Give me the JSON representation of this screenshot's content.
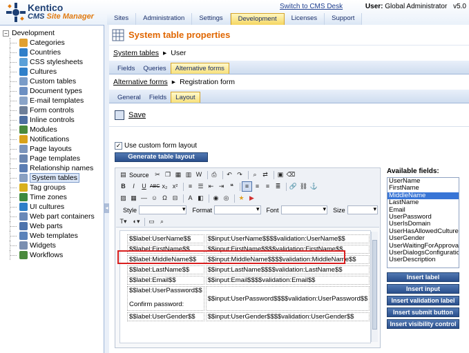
{
  "app": {
    "brand": "Kentico",
    "product_prefix": "CMS ",
    "product_suffix": "Site Manager",
    "version": "v5.0"
  },
  "header": {
    "switch_link": "Switch to CMS Desk",
    "user_label": "User:",
    "user_name": "Global Administrator",
    "main_tabs": [
      "Sites",
      "Administration",
      "Settings",
      "Development",
      "Licenses",
      "Support"
    ],
    "active_tab": "Development"
  },
  "tree": {
    "root": "Development",
    "items": [
      {
        "label": "Categories",
        "icon": "categories-icon",
        "color": "#e0a030"
      },
      {
        "label": "Countries",
        "icon": "globe-icon",
        "color": "#2f7fc9"
      },
      {
        "label": "CSS stylesheets",
        "icon": "css-icon",
        "color": "#5aa0d8"
      },
      {
        "label": "Cultures",
        "icon": "globe-icon",
        "color": "#2f7fc9"
      },
      {
        "label": "Custom tables",
        "icon": "table-icon",
        "color": "#7a9cc8"
      },
      {
        "label": "Document types",
        "icon": "document-icon",
        "color": "#6c8fc2"
      },
      {
        "label": "E-mail templates",
        "icon": "email-icon",
        "color": "#8aa4c8"
      },
      {
        "label": "Form controls",
        "icon": "form-control-icon",
        "color": "#6e7f99"
      },
      {
        "label": "Inline controls",
        "icon": "inline-control-icon",
        "color": "#4e6fa1"
      },
      {
        "label": "Modules",
        "icon": "modules-icon",
        "color": "#4a8a3c"
      },
      {
        "label": "Notifications",
        "icon": "notification-icon",
        "color": "#d9a21b"
      },
      {
        "label": "Page layouts",
        "icon": "layout-icon",
        "color": "#7c95bb"
      },
      {
        "label": "Page templates",
        "icon": "template-icon",
        "color": "#6b86b0"
      },
      {
        "label": "Relationship names",
        "icon": "relationship-icon",
        "color": "#5b7db3"
      },
      {
        "label": "System tables",
        "icon": "system-table-icon",
        "color": "#8aa0c0"
      },
      {
        "label": "Tag groups",
        "icon": "tag-icon",
        "color": "#d9b01b"
      },
      {
        "label": "Time zones",
        "icon": "clock-icon",
        "color": "#3d8a3d"
      },
      {
        "label": "UI cultures",
        "icon": "ui-culture-icon",
        "color": "#2f7fc9"
      },
      {
        "label": "Web part containers",
        "icon": "container-icon",
        "color": "#6a89b8"
      },
      {
        "label": "Web parts",
        "icon": "webpart-icon",
        "color": "#4e74ad"
      },
      {
        "label": "Web templates",
        "icon": "web-template-icon",
        "color": "#5a82ba"
      },
      {
        "label": "Widgets",
        "icon": "widget-icon",
        "color": "#7b8fb1"
      },
      {
        "label": "Workflows",
        "icon": "workflow-icon",
        "color": "#4a8a3c"
      }
    ],
    "selected": "System tables"
  },
  "content": {
    "title": "System table properties",
    "breadcrumb1": {
      "link": "System tables",
      "current": "User"
    },
    "tabs1": [
      "Fields",
      "Queries",
      "Alternative forms"
    ],
    "tabs1_active": "Alternative forms",
    "breadcrumb2": {
      "link": "Alternative forms",
      "current": "Registration form"
    },
    "tabs2": [
      "General",
      "Fields",
      "Layout"
    ],
    "tabs2_active": "Layout",
    "save_label": "Save",
    "custom_layout_label": "Use custom form layout",
    "custom_layout_checked": true,
    "generate_label": "Generate table layout"
  },
  "editor": {
    "source_label": "Source",
    "style_label": "Style",
    "format_label": "Format",
    "font_label": "Font",
    "size_label": "Size",
    "rows": [
      [
        "$$label:UserName$$",
        "$$input:UserName$$$$validation:UserName$$"
      ],
      [
        "$$label:FirstName$$",
        "$$input:FirstName$$$$validation:FirstName$$"
      ],
      [
        "$$label:MiddleName$$",
        "$$input:MiddleName$$$$validation:MiddleName$$"
      ],
      [
        "$$label:LastName$$",
        "$$input:LastName$$$$validation:LastName$$"
      ],
      [
        "$$label:Email$$",
        "$$input:Email$$$$validation:Email$$"
      ],
      [
        "$$label:UserPassword$$",
        "$$input:UserPassword$$$$validation:UserPassword$$"
      ],
      [
        "$$label:UserGender$$",
        "$$input:UserGender$$$$validation:UserGender$$"
      ]
    ],
    "confirm_label": "Confirm password:"
  },
  "available": {
    "title": "Available fields:",
    "fields": [
      "UserName",
      "FirstName",
      "MiddleName",
      "LastName",
      "Email",
      "UserPassword",
      "UserIsDomain",
      "UserHasAllowedCultures",
      "UserGender",
      "UserWaitingForApproval",
      "UserDialogsConfiguration",
      "UserDescription"
    ],
    "selected": "MiddleName",
    "buttons": [
      "Insert label",
      "Insert input",
      "Insert validation label",
      "Insert submit button",
      "Insert visibility control"
    ]
  },
  "colors": {
    "accent_orange": "#e06600",
    "nav_blue": "#1a2f6a",
    "highlight_red": "#d81e1e",
    "selection_blue": "#3875d6"
  }
}
